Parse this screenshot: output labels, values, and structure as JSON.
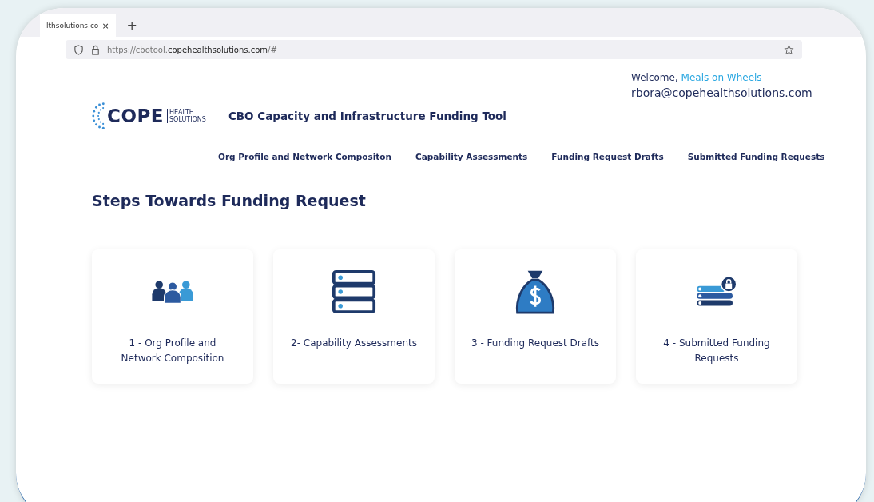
{
  "browser": {
    "tab": {
      "title": "lthsolutions.co",
      "close": "×"
    },
    "new_tab": "+",
    "url": "https://cbotool.**copehealthsolutions.com**/#"
  },
  "user": {
    "welcome": "Welcome,",
    "org": "Meals on Wheels",
    "email": "rbora@copehealthsolutions.com"
  },
  "logo": {
    "name": "COPE",
    "sub1": "HEALTH",
    "sub2": "SOLUTIONS"
  },
  "app_title": "CBO Capacity and Infrastructure Funding Tool",
  "nav": [
    "Org Profile and Network Compositon",
    "Capability Assessments",
    "Funding Request Drafts",
    "Submitted Funding Requests"
  ],
  "heading": "Steps Towards Funding Request",
  "cards": [
    {
      "kind": "people",
      "label": "1 - Org Profile and Network Composition"
    },
    {
      "kind": "server",
      "label": "2- Capability Assessments"
    },
    {
      "kind": "moneybag",
      "label": "3 - Funding Request Drafts"
    },
    {
      "kind": "stack",
      "label": "4 - Submitted Funding Requests"
    }
  ]
}
